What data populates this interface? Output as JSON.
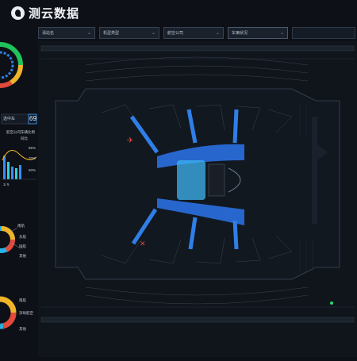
{
  "app": {
    "title": "测云数据"
  },
  "filters": [
    {
      "value": "请站名",
      "width": 72
    },
    {
      "value": "机型类型",
      "width": 76
    },
    {
      "value": "航空公司",
      "width": 76
    },
    {
      "value": "车辆状况",
      "width": 76
    }
  ],
  "left_panel": {
    "box_label": "选中车",
    "box_value": "69",
    "chart_title": "航空公司车辆比例",
    "chart_subtitle": "同比",
    "pct_labels": [
      "85%",
      "70%",
      "50%"
    ],
    "bar_axis": "1/ 5",
    "donut2_labels": [
      "南航",
      "东航",
      "国航",
      "其他"
    ],
    "donut3_labels": [
      "南航",
      "深圳航空",
      "其他"
    ]
  },
  "map": {
    "zoom": "100%"
  },
  "colors": {
    "accent": "#3d8bff",
    "bg": "#0d1016",
    "panel": "#151b24"
  }
}
